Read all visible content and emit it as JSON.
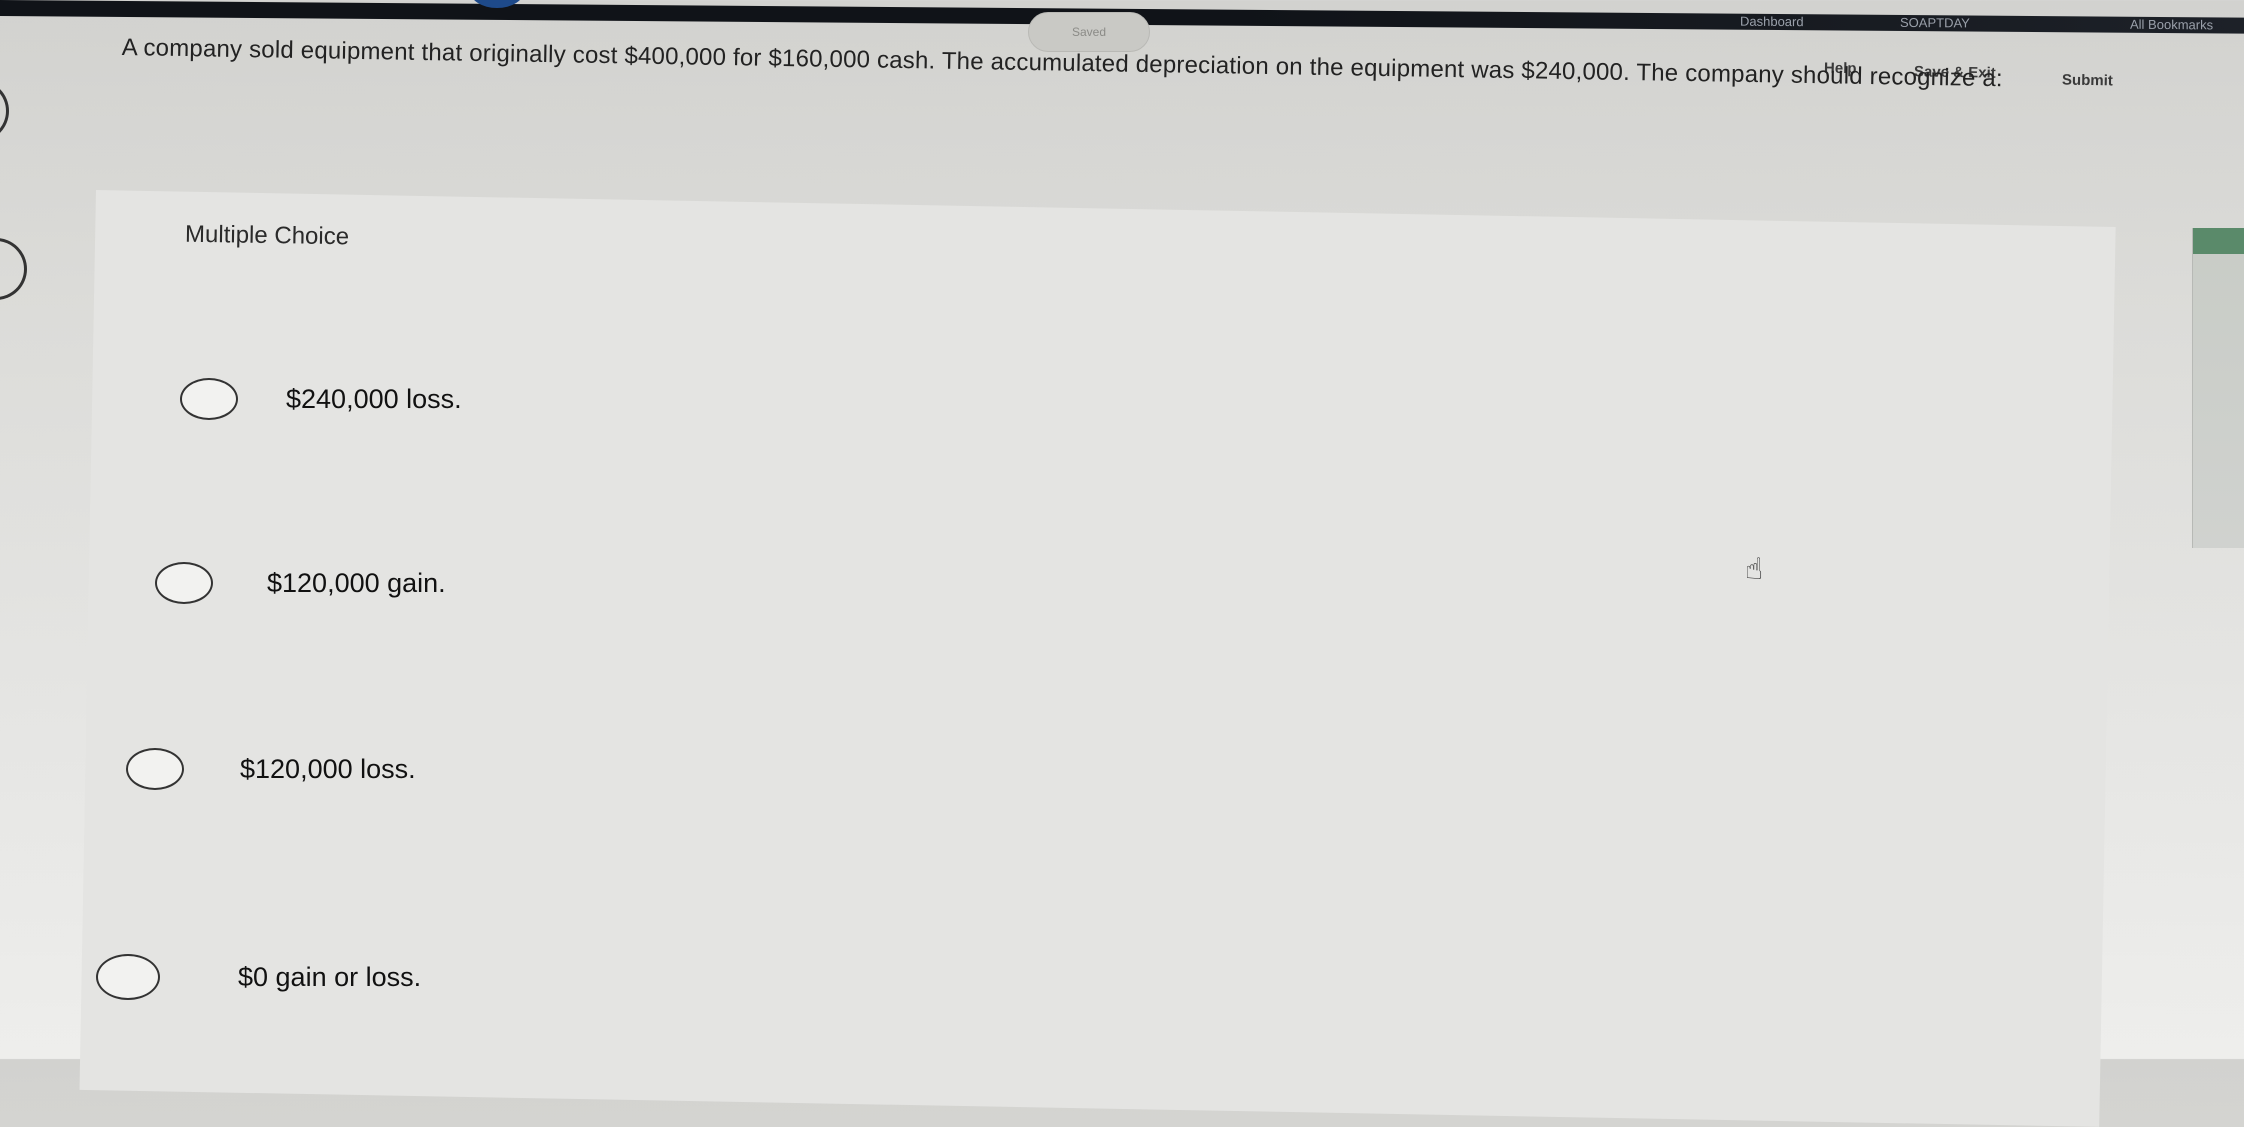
{
  "browser": {
    "bookmarks": [
      "Dashboard",
      "SOAPTDAY",
      "All Bookmarks"
    ]
  },
  "status": {
    "saved_label": "Saved"
  },
  "header": {
    "help_label": "Help",
    "save_exit_label": "Save & Exit",
    "submit_label": "Submit"
  },
  "question": {
    "text": "A company sold equipment that originally cost $400,000 for $160,000 cash. The accumulated depreciation on the equipment was $240,000. The company should recognize a:"
  },
  "panel": {
    "heading": "Multiple Choice"
  },
  "choices": [
    {
      "label": "$240,000 loss."
    },
    {
      "label": "$120,000 gain."
    },
    {
      "label": "$120,000 loss."
    },
    {
      "label": "$0 gain or loss."
    }
  ],
  "icons": {
    "cursor": "hand-pointer-icon",
    "radio": "radio-circle-icon"
  }
}
